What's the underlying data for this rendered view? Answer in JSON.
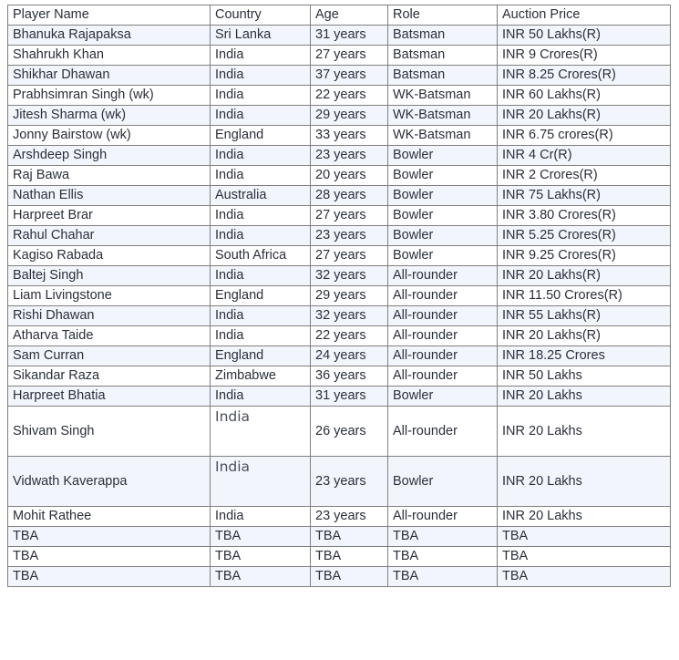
{
  "table": {
    "name": "ipl-squad-table",
    "columns": [
      {
        "key": "player",
        "label": "Player Name"
      },
      {
        "key": "country",
        "label": "Country"
      },
      {
        "key": "age",
        "label": "Age"
      },
      {
        "key": "role",
        "label": "Role"
      },
      {
        "key": "price",
        "label": "Auction Price"
      }
    ],
    "rows": [
      {
        "player": "Bhanuka Rajapaksa",
        "country": "Sri Lanka",
        "age": "31 years",
        "role": "Batsman",
        "price": "INR 50 Lakhs(R)"
      },
      {
        "player": "Shahrukh Khan",
        "country": "India",
        "age": "27 years",
        "role": "Batsman",
        "price": "INR 9 Crores(R)"
      },
      {
        "player": "Shikhar Dhawan",
        "country": "India",
        "age": "37 years",
        "role": "Batsman",
        "price": "INR 8.25 Crores(R)"
      },
      {
        "player": "Prabhsimran Singh (wk)",
        "country": "India",
        "age": "22 years",
        "role": "WK-Batsman",
        "price": "INR 60 Lakhs(R)"
      },
      {
        "player": "Jitesh Sharma (wk)",
        "country": "India",
        "age": "29 years",
        "role": "WK-Batsman",
        "price": "INR 20 Lakhs(R)"
      },
      {
        "player": "Jonny Bairstow (wk)",
        "country": "England",
        "age": "33 years",
        "role": "WK-Batsman",
        "price": "INR 6.75 crores(R)"
      },
      {
        "player": "Arshdeep Singh",
        "country": "India",
        "age": "23 years",
        "role": "Bowler",
        "price": "INR 4 Cr(R)"
      },
      {
        "player": "Raj Bawa",
        "country": "India",
        "age": "20 years",
        "role": "Bowler",
        "price": "INR 2 Crores(R)"
      },
      {
        "player": "Nathan Ellis",
        "country": "Australia",
        "age": "28 years",
        "role": "Bowler",
        "price": "INR 75 Lakhs(R)"
      },
      {
        "player": "Harpreet Brar",
        "country": "India",
        "age": "27 years",
        "role": "Bowler",
        "price": "INR 3.80 Crores(R)"
      },
      {
        "player": "Rahul Chahar",
        "country": "India",
        "age": "23 years",
        "role": "Bowler",
        "price": "INR 5.25 Crores(R)"
      },
      {
        "player": "Kagiso Rabada",
        "country": "South Africa",
        "age": "27 years",
        "role": "Bowler",
        "price": "INR 9.25 Crores(R)"
      },
      {
        "player": "Baltej Singh",
        "country": "India",
        "age": "32 years",
        "role": "All-rounder",
        "price": "INR 20 Lakhs(R)"
      },
      {
        "player": "Liam Livingstone",
        "country": "England",
        "age": "29 years",
        "role": "All-rounder",
        "price": "INR 11.50 Crores(R)"
      },
      {
        "player": "Rishi Dhawan",
        "country": "India",
        "age": "32 years",
        "role": "All-rounder",
        "price": "INR 55 Lakhs(R)"
      },
      {
        "player": "Atharva Taide",
        "country": "India",
        "age": "22 years",
        "role": "All-rounder",
        "price": "INR 20 Lakhs(R)"
      },
      {
        "player": "Sam Curran",
        "country": "England",
        "age": "24 years",
        "role": "All-rounder",
        "price": "INR 18.25 Crores"
      },
      {
        "player": "Sikandar Raza",
        "country": "Zimbabwe",
        "age": "36 years",
        "role": "All-rounder",
        "price": "INR 50 Lakhs"
      },
      {
        "player": "Harpreet Bhatia",
        "country": "India",
        "age": "31 years",
        "role": "Bowler",
        "price": "INR 20 Lakhs"
      },
      {
        "player": "Shivam Singh",
        "country": "India",
        "age": "26 years",
        "role": "All-rounder",
        "price": "INR 20 Lakhs",
        "tall": true
      },
      {
        "player": "Vidwath Kaverappa",
        "country": "India",
        "age": "23 years",
        "role": "Bowler",
        "price": "INR 20 Lakhs",
        "tall": true
      },
      {
        "player": "Mohit Rathee",
        "country": "India",
        "age": "23 years",
        "role": "All-rounder",
        "price": "INR 20 Lakhs"
      },
      {
        "player": "TBA",
        "country": "TBA",
        "age": "TBA",
        "role": "TBA",
        "price": "TBA"
      },
      {
        "player": "TBA",
        "country": "TBA",
        "age": "TBA",
        "role": "TBA",
        "price": "TBA"
      },
      {
        "player": "TBA",
        "country": "TBA",
        "age": "TBA",
        "role": "TBA",
        "price": "TBA"
      }
    ]
  },
  "colors": {
    "border": "#7f7f7f",
    "stripe": "#f2f6fc",
    "base": "#ffffff",
    "text": "#2a2f3a"
  }
}
